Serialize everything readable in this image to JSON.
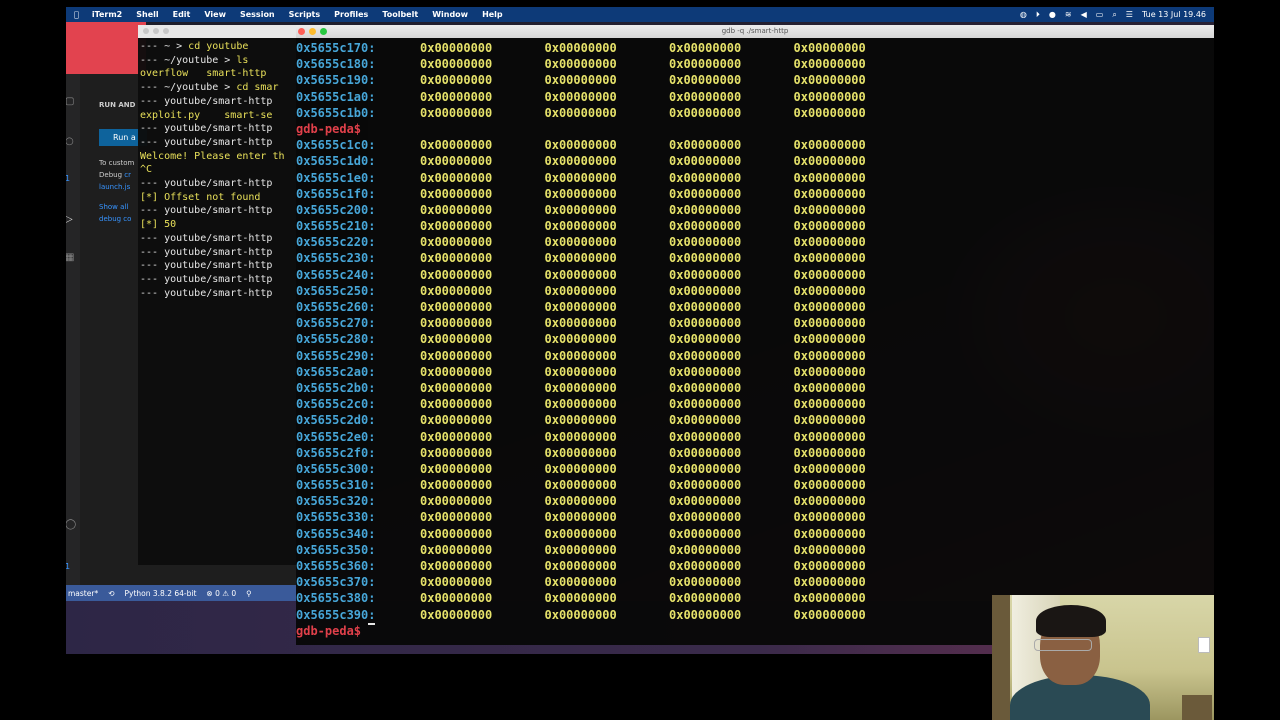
{
  "menubar": {
    "apple": "",
    "app": "iTerm2",
    "items": [
      "Shell",
      "Edit",
      "View",
      "Session",
      "Scripts",
      "Profiles",
      "Toolbelt",
      "Window",
      "Help"
    ],
    "clock": "Tue 13 Jul  19.46"
  },
  "vscode": {
    "panel_title": "RUN AND",
    "run_button": "Run a",
    "customize_text": "To custom",
    "debug_text": "Debug",
    "debug_link": "cr",
    "launch_link": "launch.js",
    "show_all": "Show all",
    "debug_commands": "debug co",
    "badge1": "1",
    "badge2": "1"
  },
  "statusbar": {
    "branch": "master*",
    "python": "Python 3.8.2 64-bit",
    "errors": "0",
    "warnings": "0"
  },
  "left_terminal": {
    "lines": [
      {
        "p": "--- ~ > ",
        "t": "cd youtube"
      },
      {
        "p": "--- ~/youtube > ",
        "t": "ls"
      },
      {
        "p": "",
        "t": "overflow   smart-http"
      },
      {
        "p": "--- ~/youtube > ",
        "t": "cd smar"
      },
      {
        "p": "--- youtube/smart-http",
        "t": ""
      },
      {
        "p": "",
        "t": "exploit.py    smart-se"
      },
      {
        "p": "--- youtube/smart-http",
        "t": ""
      },
      {
        "p": "--- youtube/smart-http",
        "t": ""
      },
      {
        "p": "",
        "t": "Welcome! Please enter th"
      },
      {
        "p": "",
        "t": "^C"
      },
      {
        "p": "--- youtube/smart-http",
        "t": ""
      },
      {
        "p": "",
        "t": "[*] Offset not found"
      },
      {
        "p": "--- youtube/smart-http",
        "t": ""
      },
      {
        "p": "",
        "t": "[*] 50"
      },
      {
        "p": "--- youtube/smart-http",
        "t": ""
      },
      {
        "p": "--- youtube/smart-http",
        "t": ""
      },
      {
        "p": "--- youtube/smart-http",
        "t": ""
      },
      {
        "p": "--- youtube/smart-http",
        "t": ""
      },
      {
        "p": "--- youtube/smart-http",
        "t": ""
      }
    ]
  },
  "gdb": {
    "title": "gdb -q ./smart-http",
    "prompt": "gdb-peda$",
    "value": "0x00000000",
    "block1": [
      "0x5655c170:",
      "0x5655c180:",
      "0x5655c190:",
      "0x5655c1a0:",
      "0x5655c1b0:"
    ],
    "block2": [
      "0x5655c1c0:",
      "0x5655c1d0:",
      "0x5655c1e0:",
      "0x5655c1f0:",
      "0x5655c200:",
      "0x5655c210:",
      "0x5655c220:",
      "0x5655c230:",
      "0x5655c240:",
      "0x5655c250:",
      "0x5655c260:",
      "0x5655c270:",
      "0x5655c280:",
      "0x5655c290:",
      "0x5655c2a0:",
      "0x5655c2b0:",
      "0x5655c2c0:",
      "0x5655c2d0:",
      "0x5655c2e0:",
      "0x5655c2f0:",
      "0x5655c300:",
      "0x5655c310:",
      "0x5655c320:",
      "0x5655c330:",
      "0x5655c340:",
      "0x5655c350:",
      "0x5655c360:",
      "0x5655c370:",
      "0x5655c380:",
      "0x5655c390:"
    ]
  }
}
